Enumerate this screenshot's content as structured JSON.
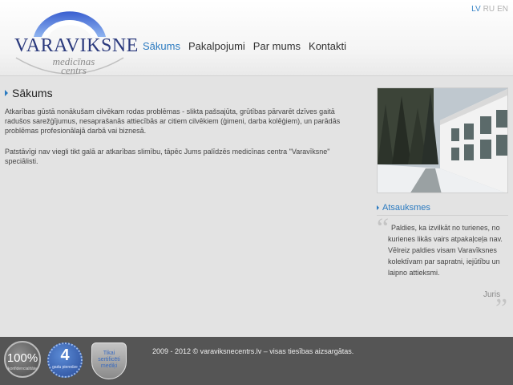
{
  "logo": {
    "wordmark": "VARAVIKSNE",
    "line1": "medicīnas",
    "line2": "centrs"
  },
  "nav": {
    "items": [
      {
        "label": "Sākums",
        "active": true
      },
      {
        "label": "Pakalpojumi",
        "active": false
      },
      {
        "label": "Par mums",
        "active": false
      },
      {
        "label": "Kontakti",
        "active": false
      }
    ]
  },
  "lang": {
    "items": [
      {
        "label": "LV",
        "active": true
      },
      {
        "label": "RU",
        "active": false
      },
      {
        "label": "EN",
        "active": false
      }
    ]
  },
  "main": {
    "title": "Sākums",
    "paragraph1": "Atkarības gūstā nonākušam cilvēkam rodas problēmas - slikta pašsajūta, grūtības pārvarēt dzīves gaitā radušos sarežģījumus, nesaprašanās attiecībās ar citiem cilvēkiem (ģimeni, darba kolēģiem), un parādās problēmas profesionālajā darbā vai biznesā.",
    "paragraph2": "Patstāvīgi nav viegli tikt galā ar atkarības slimību, tāpēc Jums palīdzēs medicīnas centra \"Varavīksne\" speciālisti."
  },
  "sidebar": {
    "testimonials_title": "Atsauksmes",
    "quote": "Paldies, ka izvilkāt no turienes, no kurienes likās vairs atpakaļceļa nav. Vēlreiz paldies visam Varavīksnes kolektīvam par sapratni, iejūtību un laipno attieksmi.",
    "author": "Juris"
  },
  "footer": {
    "copyright": "2009 - 2012 © varaviksnecentrs.lv – visas tiesības aizsargātas.",
    "badge1": {
      "big": "100%",
      "small": "konfidencialitāte"
    },
    "badge2": {
      "big": "4",
      "small": "gadu pieredze"
    },
    "badge3": {
      "text": "Tikai sertificēti mediķi"
    }
  },
  "colors": {
    "accent": "#2a7ac0",
    "logo": "#2b3a7d",
    "footer": "#555555"
  }
}
